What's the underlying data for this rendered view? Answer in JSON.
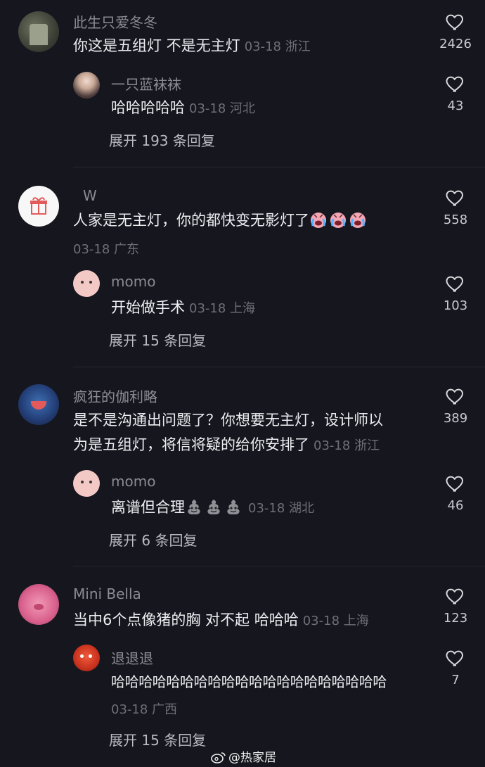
{
  "comments": [
    {
      "author": "此生只爱冬冬",
      "text": "你这是五组灯 不是无主灯",
      "meta": "03-18 浙江",
      "likes": "2426",
      "reply": {
        "author": "一只蓝袜袜",
        "text": "哈哈哈哈哈",
        "meta": "03-18 河北",
        "likes": "43"
      },
      "expand": "展开 193 条回复"
    },
    {
      "author": "W",
      "text": "人家是无主灯，你的都快变无影灯了",
      "meta": "03-18 广东",
      "likes": "558",
      "reply": {
        "author": "momo",
        "text": "开始做手术",
        "meta": "03-18 上海",
        "likes": "103"
      },
      "expand": "展开 15 条回复"
    },
    {
      "author": "疯狂的伽利略",
      "text_line1": "是不是沟通出问题了？你想要无主灯，设计师以",
      "text_line2": "为是五组灯，将信将疑的给你安排了",
      "meta": "03-18 浙江",
      "likes": "389",
      "reply": {
        "author": "momo",
        "text": "离谱但合理",
        "meta": "03-18 湖北",
        "likes": "46"
      },
      "expand": "展开 6 条回复"
    },
    {
      "author": "Mini Bella",
      "text": "当中6个点像猪的胸 对不起 哈哈哈",
      "meta": "03-18 上海",
      "likes": "123",
      "reply": {
        "author": "退退退",
        "text": "哈哈哈哈哈哈哈哈哈哈哈哈哈哈哈哈哈哈哈哈",
        "meta": "03-18 广西",
        "likes": "7"
      },
      "expand": "展开 15 条回复"
    }
  ],
  "watermark": "@热家居",
  "icons": {
    "like": "heart-outline-icon",
    "gift": "gift-icon",
    "weibo": "weibo-logo-icon",
    "emoji_cry": "crying-emoji-icon",
    "emoji_poop": "grey-poop-emoji-icon"
  },
  "colors": {
    "background": "#16161e",
    "muted": "#6f6f79",
    "author": "#8b8b95"
  }
}
